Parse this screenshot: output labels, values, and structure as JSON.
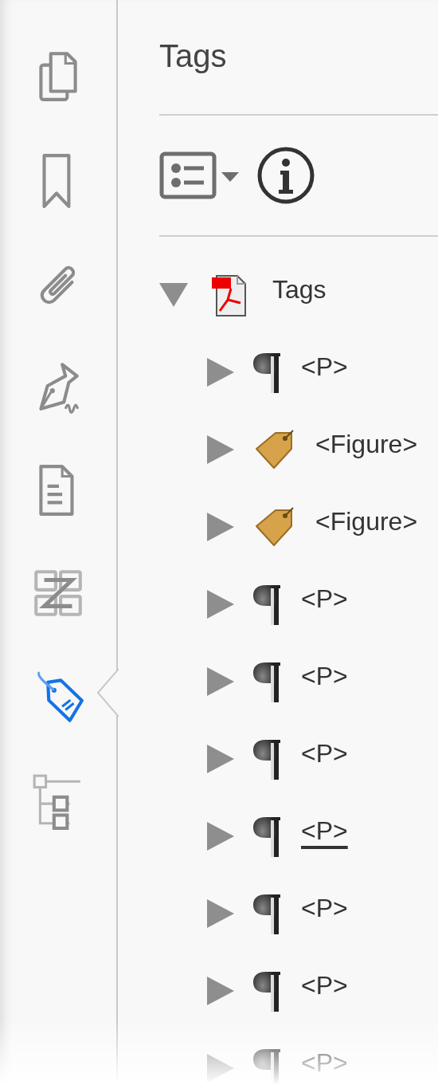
{
  "sidebar": {
    "items": [
      {
        "kind": "pages",
        "selected": false
      },
      {
        "kind": "bookmark",
        "selected": false
      },
      {
        "kind": "attachment",
        "selected": false
      },
      {
        "kind": "signature",
        "selected": false
      },
      {
        "kind": "document",
        "selected": false
      },
      {
        "kind": "links",
        "selected": false
      },
      {
        "kind": "tag",
        "selected": true
      },
      {
        "kind": "structure",
        "selected": false
      }
    ]
  },
  "panel": {
    "title": "Tags",
    "toolbar": [
      {
        "kind": "options-menu"
      },
      {
        "kind": "info"
      }
    ],
    "tree": [
      {
        "label": "Tags",
        "kind": "root",
        "expanded": true,
        "children": [
          {
            "label": "<P>",
            "kind": "paragraph",
            "expanded": false,
            "underlined": false
          },
          {
            "label": "<Figure>",
            "kind": "figure",
            "expanded": false,
            "underlined": false
          },
          {
            "label": "<Figure>",
            "kind": "figure",
            "expanded": false,
            "underlined": false
          },
          {
            "label": "<P>",
            "kind": "paragraph",
            "expanded": false,
            "underlined": false
          },
          {
            "label": "<P>",
            "kind": "paragraph",
            "expanded": false,
            "underlined": false
          },
          {
            "label": "<P>",
            "kind": "paragraph",
            "expanded": false,
            "underlined": false
          },
          {
            "label": "<P>",
            "kind": "paragraph",
            "expanded": false,
            "underlined": true
          },
          {
            "label": "<P>",
            "kind": "paragraph",
            "expanded": false,
            "underlined": false
          },
          {
            "label": "<P>",
            "kind": "paragraph",
            "expanded": false,
            "underlined": false
          },
          {
            "label": "<P>",
            "kind": "paragraph",
            "expanded": false,
            "underlined": false
          }
        ]
      }
    ]
  }
}
